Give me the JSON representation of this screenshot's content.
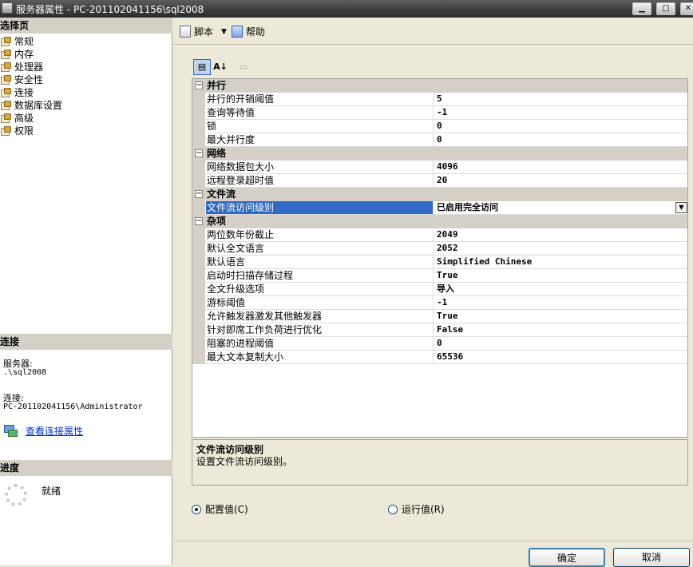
{
  "window": {
    "title": "服务器属性 - PC-201102041156\\sql2008",
    "min_glyph": "▁",
    "max_glyph": "□",
    "close_glyph": "✕"
  },
  "sidebar": {
    "select_page_header": "选择页",
    "pages": [
      {
        "label": "常规",
        "icon": "page-icon"
      },
      {
        "label": "内存",
        "icon": "page-icon"
      },
      {
        "label": "处理器",
        "icon": "page-icon"
      },
      {
        "label": "安全性",
        "icon": "page-icon"
      },
      {
        "label": "连接",
        "icon": "page-icon"
      },
      {
        "label": "数据库设置",
        "icon": "page-icon"
      },
      {
        "label": "高级",
        "icon": "page-icon"
      },
      {
        "label": "权限",
        "icon": "page-icon"
      }
    ],
    "connection_header": "连接",
    "server_label": "服务器:",
    "server_value": ".\\sql2008",
    "connection_label": "连接:",
    "connection_value": "PC-201102041156\\Administrator",
    "view_connection_link": "查看连接属性",
    "progress_header": "进度",
    "progress_status": "就绪"
  },
  "toolbar": {
    "script_label": "脚本",
    "script_dropdown": "▼",
    "help_label": "帮助"
  },
  "sortbar": {
    "categorized_glyph": "▤",
    "alpha_glyph": "A↓",
    "pages_glyph": "▭"
  },
  "grid": {
    "categories": [
      {
        "name": "并行",
        "toggle": "−",
        "rows": [
          {
            "name": "并行的开销阈值",
            "value": "5"
          },
          {
            "name": "查询等待值",
            "value": "-1"
          },
          {
            "name": "锁",
            "value": "0"
          },
          {
            "name": "最大并行度",
            "value": "0"
          }
        ]
      },
      {
        "name": "网络",
        "toggle": "−",
        "rows": [
          {
            "name": "网络数据包大小",
            "value": "4096"
          },
          {
            "name": "远程登录超时值",
            "value": "20"
          }
        ]
      },
      {
        "name": "文件流",
        "toggle": "−",
        "rows": [
          {
            "name": "文件流访问级别",
            "value": "已启用完全访问",
            "selected": true
          }
        ]
      },
      {
        "name": "杂项",
        "toggle": "−",
        "rows": [
          {
            "name": "两位数年份截止",
            "value": "2049"
          },
          {
            "name": "默认全文语言",
            "value": "2052"
          },
          {
            "name": "默认语言",
            "value": "Simplified Chinese"
          },
          {
            "name": "启动时扫描存储过程",
            "value": "True"
          },
          {
            "name": "全文升级选项",
            "value": "导入"
          },
          {
            "name": "游标阈值",
            "value": "-1"
          },
          {
            "name": "允许触发器激发其他触发器",
            "value": "True"
          },
          {
            "name": "针对即席工作负荷进行优化",
            "value": "False"
          },
          {
            "name": "阻塞的进程阈值",
            "value": "0"
          },
          {
            "name": "最大文本复制大小",
            "value": "65536"
          }
        ]
      }
    ],
    "dropdown_glyph": "▼"
  },
  "description": {
    "title": "文件流访问级别",
    "text": "设置文件流访问级别。"
  },
  "options": {
    "configured_label": "配置值(C)",
    "running_label": "运行值(R)",
    "selected": "configured"
  },
  "buttons": {
    "ok_label": "确定",
    "cancel_label": "取消"
  }
}
